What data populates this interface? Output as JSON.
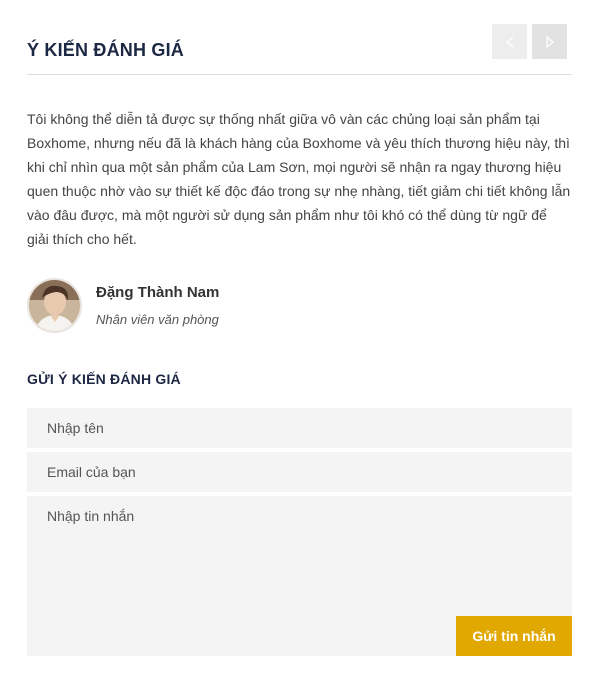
{
  "testimonials": {
    "title": "Ý KIẾN ĐÁNH GIÁ",
    "prev_icon": "chevron-left-icon",
    "next_icon": "chevron-right-icon",
    "text": "Tôi không thể diễn tả được sự thống nhất giữa vô vàn các chủng loại sản phẩm tại Boxhome, nhưng nếu đã là khách hàng của Boxhome và yêu thích thương hiệu này, thì khi chỉ nhìn qua một sản phẩm của Lam Sơn, mọi người sẽ nhận ra ngay thương hiệu quen thuộc nhờ vào sự thiết kế độc đáo trong sự nhẹ nhàng, tiết giảm chi tiết không lẫn vào đâu được, mà một người sử dụng sản phẩm như tôi khó có thể dùng từ ngữ để giải thích cho hết.",
    "author": {
      "name": "Đặng Thành Nam",
      "role": "Nhân viên văn phòng"
    }
  },
  "form": {
    "title": "GỬI Ý KIẾN ĐÁNH GIÁ",
    "name_placeholder": "Nhập tên",
    "email_placeholder": "Email của bạn",
    "message_placeholder": "Nhập tin nhắn",
    "submit_label": "Gửi tin nhắn"
  },
  "colors": {
    "heading": "#1c2743",
    "accent": "#e0a800",
    "field_bg": "#f4f4f4"
  }
}
